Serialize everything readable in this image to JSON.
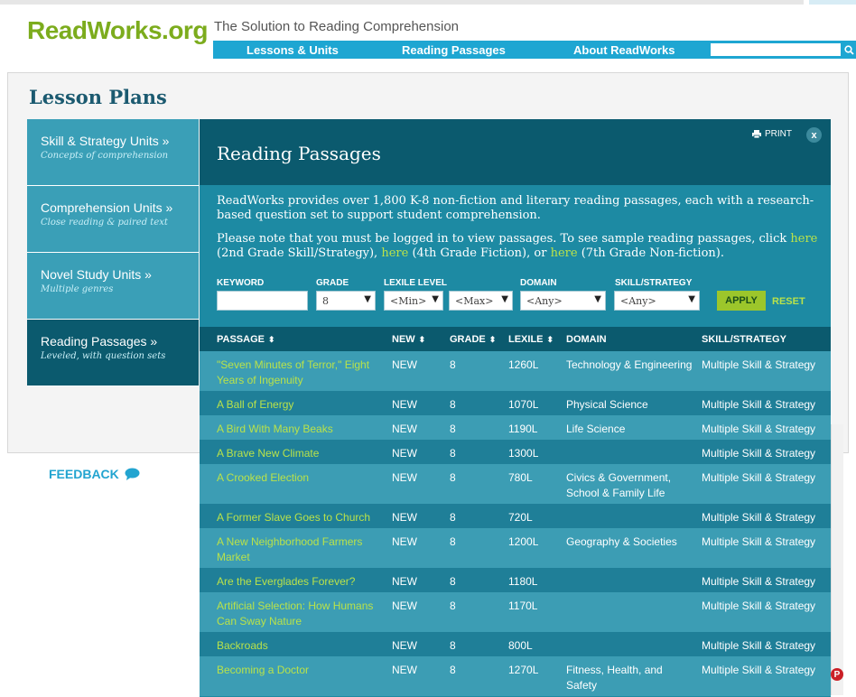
{
  "header": {
    "logo": "ReadWorks.org",
    "tagline": "The Solution to Reading Comprehension",
    "nav": [
      "Lessons & Units",
      "Reading Passages",
      "About ReadWorks"
    ],
    "search_placeholder": ""
  },
  "page_title": "Lesson Plans",
  "sidebar": {
    "items": [
      {
        "label": "Skill & Strategy Units »",
        "sub": "Concepts of comprehension"
      },
      {
        "label": "Comprehension Units »",
        "sub": "Close reading & paired text"
      },
      {
        "label": "Novel Study Units »",
        "sub": "Multiple genres"
      },
      {
        "label": "Reading Passages »",
        "sub": "Leveled, with question sets"
      }
    ]
  },
  "passages": {
    "title": "Reading Passages",
    "print_label": "PRINT",
    "close_label": "x",
    "intro": "ReadWorks provides over 1,800 K-8 non-fiction and literary reading passages, each with a research-based question set to support student comprehension.",
    "note": {
      "part1": "Please note that you must be logged in to view passages. To see sample reading passages, click ",
      "link1": "here",
      "part2": " (2nd Grade Skill/Strategy), ",
      "link2": "here",
      "part3": " (4th Grade Fiction), or ",
      "link3": "here",
      "part4": " (7th Grade Non-fiction)."
    },
    "filters": {
      "keyword_label": "KEYWORD",
      "keyword_value": "",
      "grade_label": "GRADE",
      "grade_value": "8",
      "lexile_label": "LEXILE LEVEL",
      "lexile_min": "<Min>",
      "lexile_max": "<Max>",
      "domain_label": "DOMAIN",
      "domain_value": "<Any>",
      "skill_label": "SKILL/STRATEGY",
      "skill_value": "<Any>",
      "apply_label": "APPLY",
      "reset_label": "RESET"
    },
    "columns": [
      "PASSAGE",
      "NEW",
      "GRADE",
      "LEXILE",
      "DOMAIN",
      "SKILL/STRATEGY"
    ],
    "rows": [
      {
        "title": "\"Seven Minutes of Terror,\" Eight Years of Ingenuity",
        "new": "NEW",
        "grade": "8",
        "lexile": "1260L",
        "domain": "Technology & Engineering",
        "skill": "Multiple Skill & Strategy"
      },
      {
        "title": "A Ball of Energy",
        "new": "NEW",
        "grade": "8",
        "lexile": "1070L",
        "domain": "Physical Science",
        "skill": "Multiple Skill & Strategy"
      },
      {
        "title": "A Bird With Many Beaks",
        "new": "NEW",
        "grade": "8",
        "lexile": "1190L",
        "domain": "Life Science",
        "skill": "Multiple Skill & Strategy"
      },
      {
        "title": "A Brave New Climate",
        "new": "NEW",
        "grade": "8",
        "lexile": "1300L",
        "domain": "",
        "skill": "Multiple Skill & Strategy"
      },
      {
        "title": "A Crooked Election",
        "new": "NEW",
        "grade": "8",
        "lexile": "780L",
        "domain": "Civics & Government, School & Family Life",
        "skill": "Multiple Skill & Strategy"
      },
      {
        "title": "A Former Slave Goes to Church",
        "new": "NEW",
        "grade": "8",
        "lexile": "720L",
        "domain": "",
        "skill": "Multiple Skill & Strategy"
      },
      {
        "title": "A New Neighborhood Farmers Market",
        "new": "NEW",
        "grade": "8",
        "lexile": "1200L",
        "domain": "Geography & Societies",
        "skill": "Multiple Skill & Strategy"
      },
      {
        "title": "Are the Everglades Forever?",
        "new": "NEW",
        "grade": "8",
        "lexile": "1180L",
        "domain": "",
        "skill": "Multiple Skill & Strategy"
      },
      {
        "title": "Artificial Selection: How Humans Can Sway Nature",
        "new": "NEW",
        "grade": "8",
        "lexile": "1170L",
        "domain": "",
        "skill": "Multiple Skill & Strategy"
      },
      {
        "title": "Backroads",
        "new": "NEW",
        "grade": "8",
        "lexile": "800L",
        "domain": "",
        "skill": "Multiple Skill & Strategy"
      },
      {
        "title": "Becoming a Doctor",
        "new": "NEW",
        "grade": "8",
        "lexile": "1270L",
        "domain": "Fitness, Health, and Safety",
        "skill": "Multiple Skill & Strategy"
      }
    ]
  },
  "feedback_label": "FEEDBACK",
  "colors": {
    "brand_green": "#7cac1d",
    "nav_blue": "#1ea6d2",
    "dark_teal": "#0b5a6e",
    "row_light": "#3c9db4",
    "row_dark": "#1f7f98",
    "link_green": "#b9e24a"
  }
}
